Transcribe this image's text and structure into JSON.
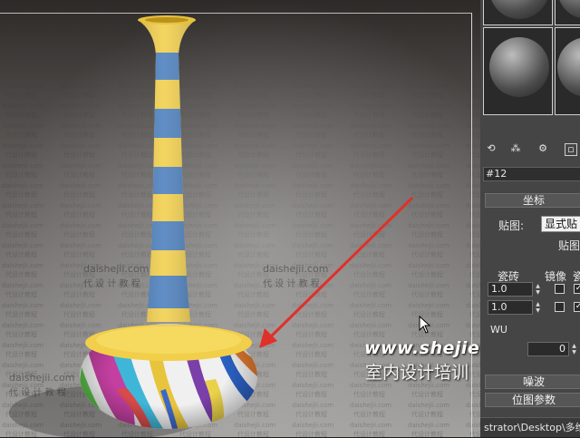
{
  "viewport": {
    "floor_tile_text_1": "daishejii.com",
    "floor_tile_text_2": "代 设 计 教 程"
  },
  "watermark": {
    "url": "www.shejiedu.com",
    "name": "室内设计培训"
  },
  "material_panel": {
    "material_name": "#12",
    "coordinates_title": "坐标",
    "map_label": "贴图:",
    "map_dropdown_value": "显式贴",
    "map_label_2": "贴图",
    "tiling_label": "瓷砖",
    "mirror_label": "镜像",
    "tile_label": "瓷",
    "u_tiling": "1.0",
    "v_tiling": "1.0",
    "wu_label": "WU",
    "w_angle": "0",
    "noise_title": "噪波",
    "bitmap_params_title": "位图参数"
  },
  "statusbar": {
    "path": "strator\\Desktop\\多维材"
  },
  "colors": {
    "vase_yellow": "#f2cf4a",
    "vase_blue": "#4a7ebd",
    "arrow_red": "#e0302a",
    "panel_bg": "#454545"
  }
}
